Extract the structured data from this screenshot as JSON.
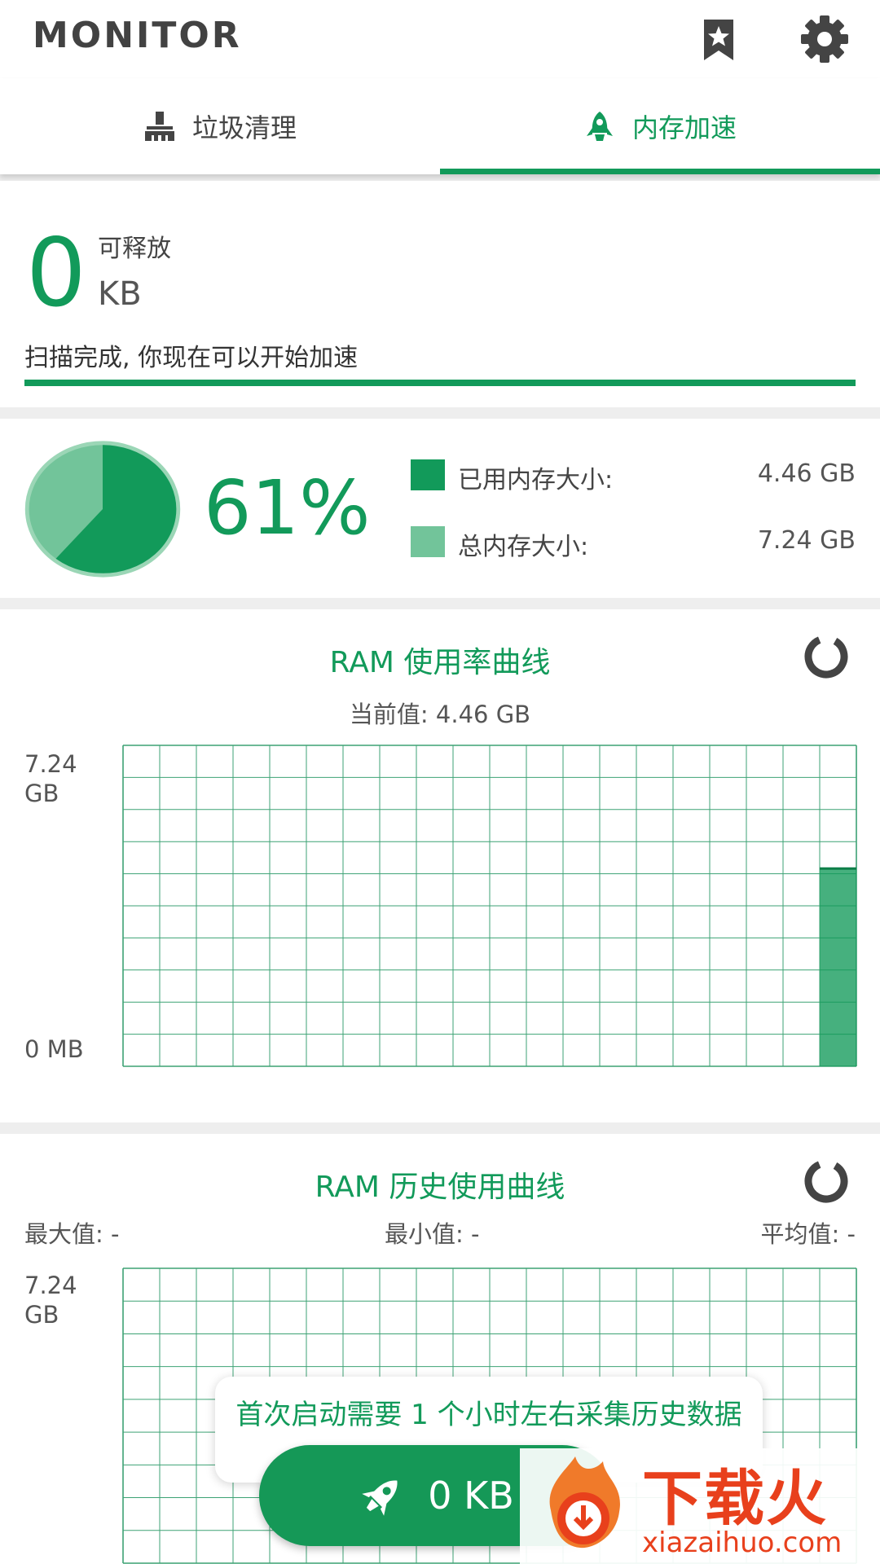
{
  "appbar": {
    "title": "MONITOR",
    "icons": [
      "bookmark-star-icon",
      "gear-icon"
    ]
  },
  "tabs": [
    {
      "label": "垃圾清理",
      "icon": "broom-icon",
      "active": false
    },
    {
      "label": "内存加速",
      "icon": "rocket-icon",
      "active": true
    }
  ],
  "release": {
    "amount": "0",
    "label": "可释放",
    "unit": "KB",
    "status": "扫描完成, 你现在可以开始加速",
    "progress": 1.0
  },
  "memory": {
    "percent": "61%",
    "used_fraction": 0.61,
    "used_label": "已用内存大小:",
    "used_value": "4.46 GB",
    "total_label": "总内存大小:",
    "total_value": "7.24 GB"
  },
  "usage_chart": {
    "title": "RAM 使用率曲线",
    "current_label": "当前值: 4.46 GB",
    "y_max_label": "7.24\nGB",
    "y_min_label": "0 MB"
  },
  "history_chart": {
    "title": "RAM 历史使用曲线",
    "max_label": "最大值: -",
    "min_label": "最小值: -",
    "avg_label": "平均值: -",
    "y_max_label": "7.24\nGB"
  },
  "chart_data": [
    {
      "type": "area",
      "title": "RAM 使用率曲线",
      "ylim": [
        0,
        7.24
      ],
      "yticks": [
        "0 MB",
        "7.24 GB"
      ],
      "series": [
        {
          "values": [
            4.46
          ]
        }
      ],
      "grid": true
    },
    {
      "type": "area",
      "title": "RAM 历史使用曲线",
      "ylim": [
        0,
        7.24
      ],
      "yticks": [
        "7.24 GB"
      ],
      "series": [],
      "grid": true
    }
  ],
  "toast": {
    "text": "首次启动需要 1 个小时左右采集历史数据"
  },
  "fab": {
    "label": "0 KB",
    "icon": "rocket-icon"
  },
  "watermark": {
    "brand": "下载火",
    "site": "xiazaihuo.com"
  },
  "colors": {
    "accent": "#129a5a",
    "accent_light": "#72c49a",
    "brand_orange": "#e8401c"
  }
}
